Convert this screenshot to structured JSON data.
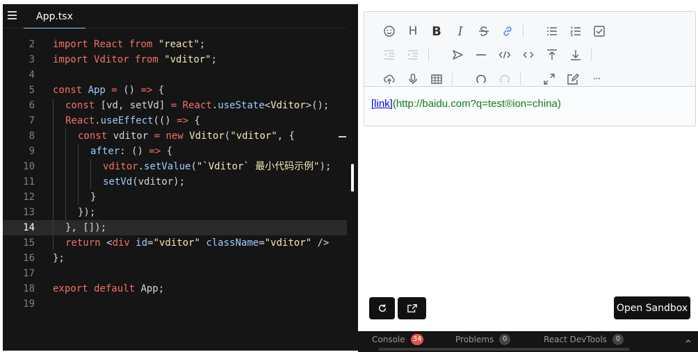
{
  "editor": {
    "tab_label": "App.tsx",
    "lines": [
      {
        "n": "2",
        "indent": 0,
        "tokens": [
          [
            "kw",
            "import "
          ],
          [
            "cls",
            "React"
          ],
          [
            "kw",
            " from "
          ],
          [
            "str",
            "\"react\""
          ],
          [
            "plain",
            ";"
          ]
        ]
      },
      {
        "n": "3",
        "indent": 0,
        "tokens": [
          [
            "kw",
            "import "
          ],
          [
            "cls",
            "Vditor"
          ],
          [
            "kw",
            " from "
          ],
          [
            "str",
            "\"vditor\""
          ],
          [
            "plain",
            ";"
          ]
        ]
      },
      {
        "n": "4",
        "indent": 0,
        "tokens": []
      },
      {
        "n": "5",
        "indent": 0,
        "tokens": [
          [
            "kw",
            "const "
          ],
          [
            "fn",
            "App"
          ],
          [
            "kw",
            " = "
          ],
          [
            "plain",
            "() "
          ],
          [
            "kw",
            "=> "
          ],
          [
            "plain",
            "{"
          ]
        ]
      },
      {
        "n": "6",
        "indent": 1,
        "tokens": [
          [
            "kw",
            "const "
          ],
          [
            "plain",
            "[vd, setVd] "
          ],
          [
            "kw",
            "= "
          ],
          [
            "cls",
            "React"
          ],
          [
            "plain",
            "."
          ],
          [
            "fn",
            "useState"
          ],
          [
            "plain",
            "<"
          ],
          [
            "str",
            "Vditor"
          ],
          [
            "plain",
            ">();"
          ]
        ]
      },
      {
        "n": "7",
        "indent": 1,
        "tokens": [
          [
            "cls",
            "React"
          ],
          [
            "plain",
            "."
          ],
          [
            "fn",
            "useEffect"
          ],
          [
            "plain",
            "(() "
          ],
          [
            "kw",
            "=> "
          ],
          [
            "plain",
            "{"
          ]
        ]
      },
      {
        "n": "8",
        "indent": 2,
        "tokens": [
          [
            "kw",
            "const "
          ],
          [
            "plain",
            "vditor "
          ],
          [
            "kw",
            "= new "
          ],
          [
            "str",
            "Vditor"
          ],
          [
            "plain",
            "("
          ],
          [
            "str",
            "\"vditor\""
          ],
          [
            "plain",
            ", {"
          ]
        ]
      },
      {
        "n": "9",
        "indent": 3,
        "tokens": [
          [
            "fn",
            "after"
          ],
          [
            "plain",
            ": () "
          ],
          [
            "kw",
            "=> "
          ],
          [
            "plain",
            "{"
          ]
        ]
      },
      {
        "n": "10",
        "indent": 4,
        "tokens": [
          [
            "cls",
            "vditor"
          ],
          [
            "plain",
            "."
          ],
          [
            "fn",
            "setValue"
          ],
          [
            "plain",
            "("
          ],
          [
            "str",
            "\"`Vditor` 最小代码示例\""
          ],
          [
            "plain",
            ");"
          ]
        ]
      },
      {
        "n": "11",
        "indent": 4,
        "tokens": [
          [
            "fn",
            "setVd"
          ],
          [
            "plain",
            "(vditor);"
          ]
        ]
      },
      {
        "n": "12",
        "indent": 3,
        "tokens": [
          [
            "plain",
            "}"
          ]
        ]
      },
      {
        "n": "13",
        "indent": 2,
        "tokens": [
          [
            "plain",
            "});"
          ]
        ]
      },
      {
        "n": "14",
        "indent": 1,
        "active": true,
        "tokens": [
          [
            "plain",
            "}, []);"
          ]
        ]
      },
      {
        "n": "15",
        "indent": 1,
        "tokens": [
          [
            "kw",
            "return "
          ],
          [
            "plain",
            "<"
          ],
          [
            "kw",
            "div "
          ],
          [
            "fn",
            "id"
          ],
          [
            "plain",
            "="
          ],
          [
            "str",
            "\"vditor\" "
          ],
          [
            "fn",
            "className"
          ],
          [
            "plain",
            "="
          ],
          [
            "str",
            "\"vditor\""
          ],
          [
            "plain",
            " />"
          ]
        ]
      },
      {
        "n": "16",
        "indent": 0,
        "tokens": [
          [
            "plain",
            "};"
          ]
        ]
      },
      {
        "n": "17",
        "indent": 0,
        "tokens": []
      },
      {
        "n": "18",
        "indent": 0,
        "tokens": [
          [
            "kw",
            "export default "
          ],
          [
            "plain",
            "App;"
          ]
        ]
      },
      {
        "n": "19",
        "indent": 0,
        "tokens": []
      }
    ]
  },
  "toolbar": {
    "rows": [
      [
        "emoji-icon",
        "headings-icon",
        "bold-icon",
        "italic-icon",
        "strike-icon",
        "link-icon",
        "|",
        "list-icon",
        "ordered-list-icon",
        "check-icon"
      ],
      [
        "outdent-icon",
        "indent-icon",
        "|",
        "quote-icon",
        "line-icon",
        "code-icon",
        "inline-code-icon",
        "insert-before-icon",
        "insert-after-icon",
        "|"
      ],
      [
        "upload-icon",
        "record-icon",
        "table-icon",
        "|",
        "undo-icon",
        "redo-icon",
        "|",
        "fullscreen-icon",
        "edit-mode-icon",
        "more-icon"
      ]
    ],
    "heading_glyph": "H",
    "bold_glyph": "B",
    "italic_glyph": "I",
    "more_glyph": "···"
  },
  "content": {
    "link_text": "[link]",
    "url_text": "(http://baidu.com?q=test®ion=china)"
  },
  "buttons": {
    "open_sandbox": "Open Sandbox"
  },
  "bottom_panel": {
    "tabs": [
      {
        "label": "Console",
        "badge": "34",
        "badge_color": "#e5534b"
      },
      {
        "label": "Problems",
        "badge": "0",
        "badge_color": "#444444"
      },
      {
        "label": "React DevTools",
        "badge": "0",
        "badge_color": "#444444"
      }
    ]
  },
  "colors": {
    "editor_bg": "#151515",
    "keyword": "#f47067",
    "string": "#f3e8b2",
    "function": "#9ecbff"
  }
}
